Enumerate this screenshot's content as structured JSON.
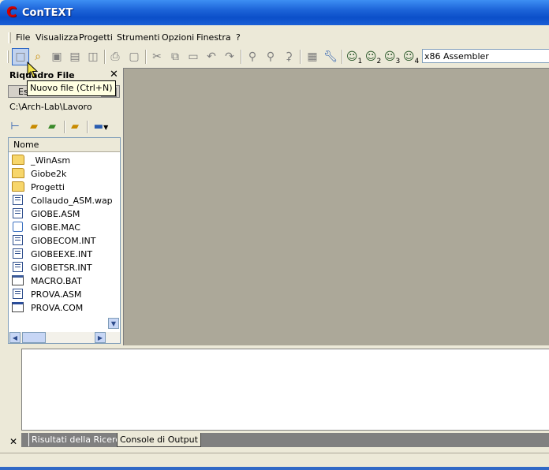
{
  "window": {
    "title": "ConTEXT",
    "app_icon": "C"
  },
  "menu": [
    "File",
    "Visualizza",
    "Progetti",
    "Strumenti",
    "Opzioni",
    "Finestra",
    "?"
  ],
  "toolbar": {
    "tooltip": "Nuovo file (Ctrl+N)",
    "language": "x86 Assembler",
    "macro_digits": [
      "1",
      "2",
      "3",
      "4"
    ]
  },
  "left_panel": {
    "title": "Riquadro File",
    "tab_label": "Es",
    "path": "C:\\Arch-Lab\\Lavoro",
    "column_header": "Nome",
    "items": [
      {
        "name": "_WinAsm",
        "icon": "folder-icon"
      },
      {
        "name": "Giobe2k",
        "icon": "folder-icon"
      },
      {
        "name": "Progetti",
        "icon": "folder-icon"
      },
      {
        "name": "Collaudo_ASM.wap",
        "icon": "document-icon"
      },
      {
        "name": "GIOBE.ASM",
        "icon": "document-icon"
      },
      {
        "name": "GIOBE.MAC",
        "icon": "mac-file-icon"
      },
      {
        "name": "GIOBECOM.INT",
        "icon": "document-icon"
      },
      {
        "name": "GIOBEEXE.INT",
        "icon": "document-icon"
      },
      {
        "name": "GIOBETSR.INT",
        "icon": "document-icon"
      },
      {
        "name": "MACRO.BAT",
        "icon": "batch-file-icon"
      },
      {
        "name": "PROVA.ASM",
        "icon": "document-icon"
      },
      {
        "name": "PROVA.COM",
        "icon": "executable-icon"
      }
    ]
  },
  "bottom_panel": {
    "tabs": [
      "Risultati della Ricerca",
      "Console di Output"
    ],
    "active_tab": "Console di Output"
  },
  "colors": {
    "title_bar": "#0b4fc9",
    "window_bg": "#ece9d8",
    "mdi_bg": "#aca899",
    "tooltip_bg": "#ffffe1"
  }
}
